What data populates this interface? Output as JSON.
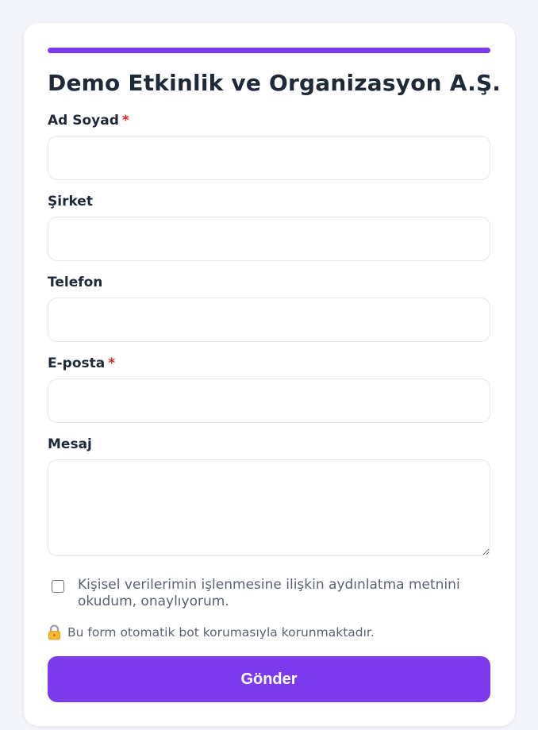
{
  "form": {
    "title": "Demo Etkinlik ve Organizasyon A.Ş.",
    "accent_color": "#7c3aed",
    "required_mark": "*",
    "fields": {
      "name": {
        "label": "Ad Soyad",
        "required": true,
        "value": ""
      },
      "company": {
        "label": "Şirket",
        "required": false,
        "value": ""
      },
      "phone": {
        "label": "Telefon",
        "required": false,
        "value": ""
      },
      "email": {
        "label": "E-posta",
        "required": true,
        "value": ""
      },
      "message": {
        "label": "Mesaj",
        "required": false,
        "value": ""
      }
    },
    "consent": {
      "checked": false,
      "text": "Kişisel verilerimin işlenmesine ilişkin aydınlatma metnini okudum, onaylıyorum."
    },
    "bot_protection_note": "Bu form otomatik bot korumasıyla korunmaktadır.",
    "bot_protection_icon": "lock-icon",
    "submit_label": "Gönder"
  }
}
